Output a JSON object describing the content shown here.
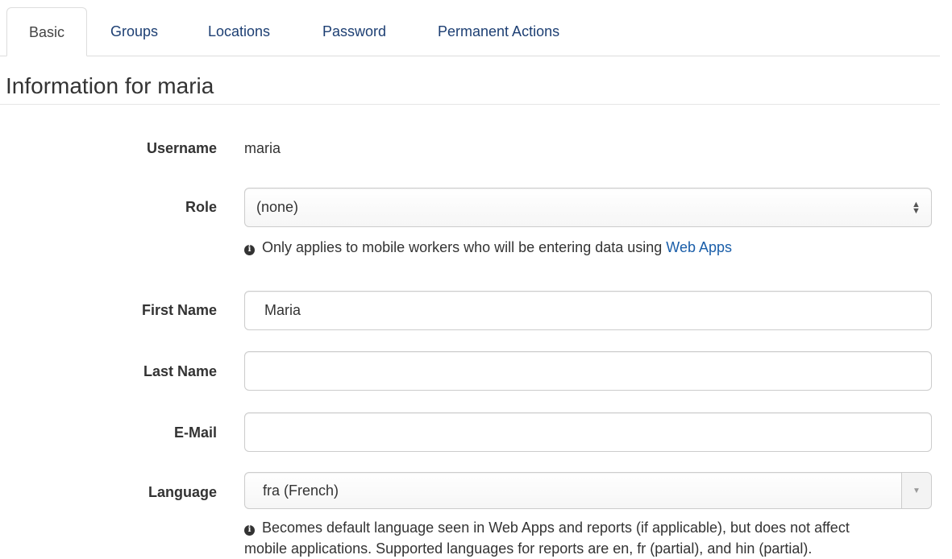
{
  "tabs": [
    {
      "label": "Basic",
      "active": true
    },
    {
      "label": "Groups",
      "active": false
    },
    {
      "label": "Locations",
      "active": false
    },
    {
      "label": "Password",
      "active": false
    },
    {
      "label": "Permanent Actions",
      "active": false
    }
  ],
  "page": {
    "title": "Information for maria"
  },
  "form": {
    "username": {
      "label": "Username",
      "value": "maria"
    },
    "role": {
      "label": "Role",
      "value": "(none)",
      "help_prefix": "Only applies to mobile workers who will be entering data using",
      "help_link": "Web Apps"
    },
    "first_name": {
      "label": "First Name",
      "value": "Maria",
      "placeholder": ""
    },
    "last_name": {
      "label": "Last Name",
      "value": "",
      "placeholder": ""
    },
    "email": {
      "label": "E-Mail",
      "value": "",
      "placeholder": ""
    },
    "language": {
      "label": "Language",
      "value": "fra (French)",
      "help_line1": "Becomes default language seen in Web Apps and reports (if applicable), but does not affect",
      "help_line2": "mobile applications. Supported languages for reports are en, fr (partial), and hin (partial)."
    }
  },
  "icons": {
    "info": "info-circle-icon",
    "select_arrows": "up-down-caret-icon",
    "dropdown": "caret-down-icon"
  },
  "colors": {
    "link": "#1a5ea9",
    "tab_text": "#1d3f73",
    "border": "#cccccc"
  }
}
